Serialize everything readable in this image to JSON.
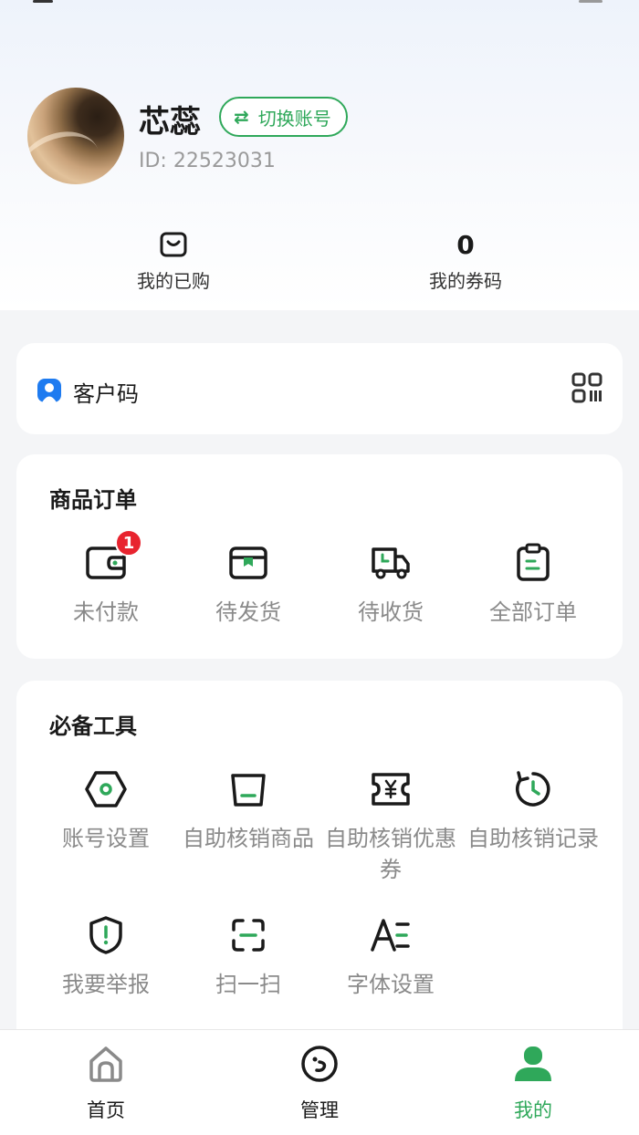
{
  "profile": {
    "name": "芯蕊",
    "switch_label": "切换账号",
    "id_text": "ID: 22523031"
  },
  "stats": {
    "purchased_label": "我的已购",
    "coupons_value": "0",
    "coupons_label": "我的券码"
  },
  "customer_code": {
    "label": "客户码"
  },
  "orders": {
    "title": "商品订单",
    "items": [
      {
        "label": "未付款",
        "icon": "wallet-icon",
        "badge": "1"
      },
      {
        "label": "待发货",
        "icon": "package-icon"
      },
      {
        "label": "待收货",
        "icon": "truck-icon"
      },
      {
        "label": "全部订单",
        "icon": "clipboard-icon"
      }
    ]
  },
  "tools": {
    "title": "必备工具",
    "items": [
      {
        "label": "账号设置",
        "icon": "settings-hex-icon"
      },
      {
        "label": "自助核销商品",
        "icon": "bag-icon"
      },
      {
        "label": "自助核销优惠券",
        "icon": "coupon-icon"
      },
      {
        "label": "自助核销记录",
        "icon": "history-icon"
      },
      {
        "label": "我要举报",
        "icon": "report-shield-icon"
      },
      {
        "label": "扫一扫",
        "icon": "scan-icon"
      },
      {
        "label": "字体设置",
        "icon": "font-size-icon"
      }
    ]
  },
  "tabbar": {
    "items": [
      {
        "label": "首页",
        "icon": "home-icon"
      },
      {
        "label": "管理",
        "icon": "manage-icon"
      },
      {
        "label": "我的",
        "icon": "user-icon",
        "active": true
      }
    ]
  },
  "colors": {
    "accent": "#2fa85a",
    "badge": "#e8242f",
    "qr_blue": "#1e7bf0"
  }
}
